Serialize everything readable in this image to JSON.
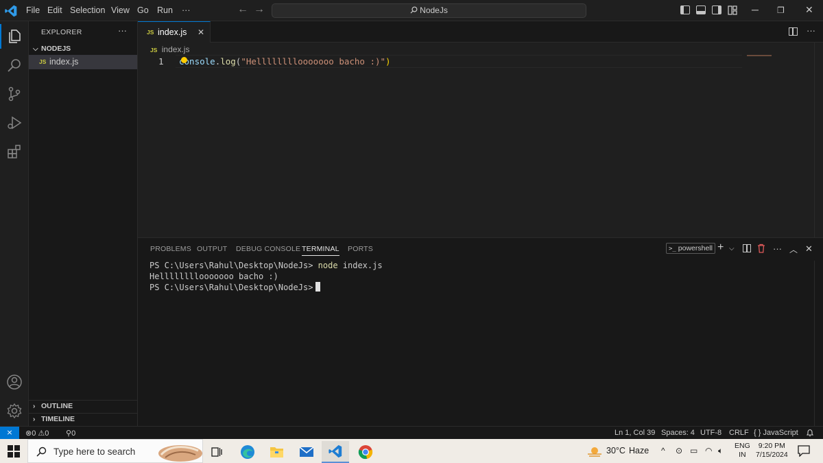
{
  "titlebar": {
    "menu": [
      "File",
      "Edit",
      "Selection",
      "View",
      "Go",
      "Run",
      "···"
    ],
    "search_text": "NodeJs"
  },
  "sidebar": {
    "title": "EXPLORER",
    "more": "···",
    "folder": "NODEJS",
    "file_badge": "JS",
    "file": "index.js",
    "outline": "OUTLINE",
    "timeline": "TIMELINE"
  },
  "editor": {
    "tab_label": "index.js",
    "tab_badge": "JS",
    "tab_close": "✕",
    "breadcrumb_badge": "JS",
    "breadcrumb": "index.js",
    "line_number": "1",
    "code": {
      "object": "console",
      "dot": ".",
      "method": "log",
      "open": "(",
      "string": "\"Hellllllllooooooo bacho :)\"",
      "close": ")"
    }
  },
  "panel": {
    "tabs": [
      "PROBLEMS",
      "OUTPUT",
      "DEBUG CONSOLE",
      "TERMINAL",
      "PORTS"
    ],
    "active_tab": "TERMINAL",
    "shell": "powershell",
    "terminal": {
      "line1_prompt": "PS C:\\Users\\Rahul\\Desktop\\NodeJs> ",
      "line1_cmd": "node",
      "line1_args": " index.js",
      "line2": "Hellllllllooooooo bacho :)",
      "line3_prompt": "PS C:\\Users\\Rahul\\Desktop\\NodeJs>"
    }
  },
  "statusbar": {
    "errors": "0",
    "warnings": "0",
    "ports": "0",
    "position": "Ln 1, Col 39",
    "spaces": "Spaces: 4",
    "encoding": "UTF-8",
    "eol": "CRLF",
    "language": "JavaScript"
  },
  "taskbar": {
    "search_placeholder": "Type here to search",
    "weather_temp": "30°C",
    "weather_desc": "Haze",
    "lang_line1": "ENG",
    "lang_line2": "IN",
    "time": "9:20 PM",
    "date": "7/15/2024"
  },
  "colors": {
    "accent": "#0078d4",
    "js_badge": "#cbcb41",
    "string": "#ce9178",
    "function": "#dcdcaa",
    "variable": "#9cdcfe"
  }
}
